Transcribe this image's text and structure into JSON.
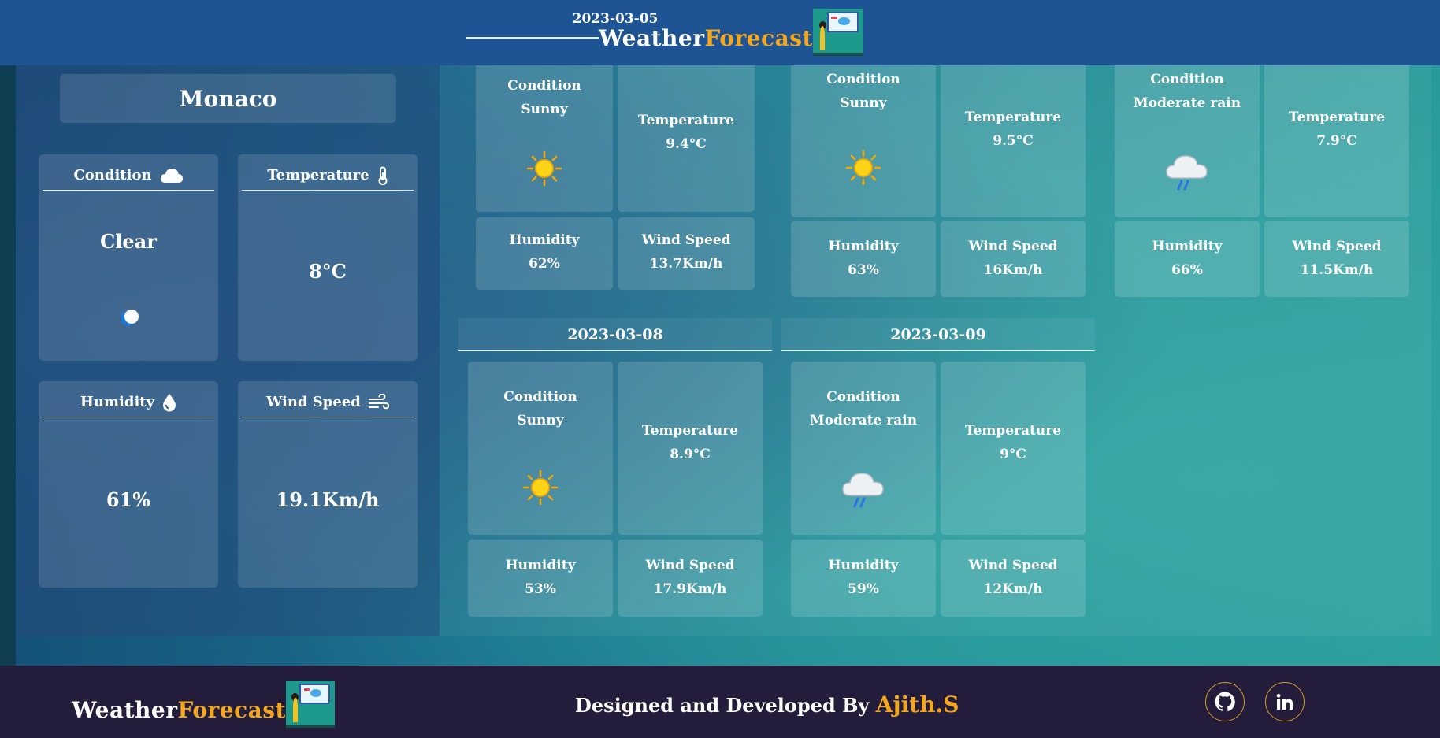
{
  "brand": {
    "word1": "Weather",
    "word2": "Forecast"
  },
  "current": {
    "city": "Monaco",
    "condition": {
      "label": "Condition",
      "value": "Clear",
      "icon": "cloud-icon",
      "value_icon": "moon-icon"
    },
    "temperature": {
      "label": "Temperature",
      "value": "8°C",
      "icon": "thermometer-icon"
    },
    "humidity": {
      "label": "Humidity",
      "value": "61%",
      "icon": "droplet-icon"
    },
    "wind": {
      "label": "Wind Speed",
      "value": "19.1Km/h",
      "icon": "wind-icon"
    }
  },
  "forecast": [
    {
      "date": "2023-03-05",
      "condition": "Sunny",
      "temperature": "9.4°C",
      "humidity": "62%",
      "wind": "13.7Km/h",
      "icon": "sun-icon"
    },
    {
      "date": "",
      "condition": "Sunny",
      "temperature": "9.5°C",
      "humidity": "63%",
      "wind": "16Km/h",
      "icon": "sun-icon"
    },
    {
      "date": "",
      "condition": "Moderate rain",
      "temperature": "7.9°C",
      "humidity": "66%",
      "wind": "11.5Km/h",
      "icon": "rain-cloud-icon"
    },
    {
      "date": "2023-03-08",
      "condition": "Sunny",
      "temperature": "8.9°C",
      "humidity": "53%",
      "wind": "17.9Km/h",
      "icon": "sun-icon"
    },
    {
      "date": "2023-03-09",
      "condition": "Moderate rain",
      "temperature": "9°C",
      "humidity": "59%",
      "wind": "12Km/h",
      "icon": "rain-cloud-icon"
    }
  ],
  "labels": {
    "condition": "Condition",
    "temperature": "Temperature",
    "humidity": "Humidity",
    "wind": "Wind Speed"
  },
  "footer": {
    "credit": "Designed and Developed By",
    "author": "Ajith.S",
    "social": [
      "github-icon",
      "linkedin-icon"
    ]
  }
}
